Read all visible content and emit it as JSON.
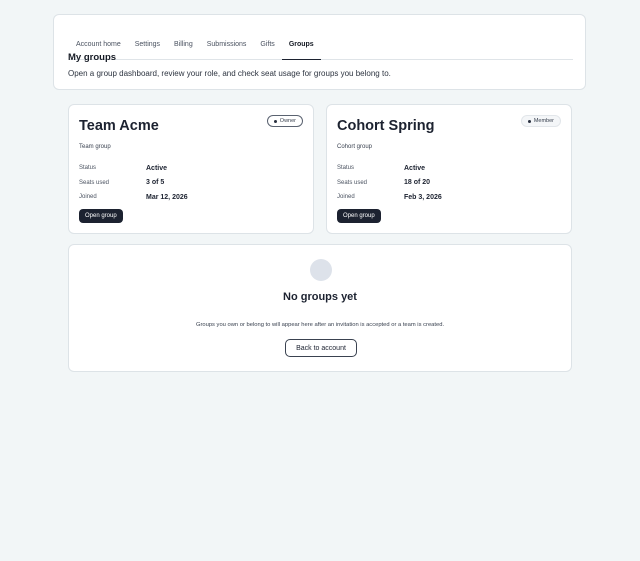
{
  "nav": {
    "tabs": [
      {
        "label": "Account home"
      },
      {
        "label": "Settings"
      },
      {
        "label": "Billing"
      },
      {
        "label": "Submissions"
      },
      {
        "label": "Gifts"
      },
      {
        "label": "Groups",
        "active": true
      }
    ]
  },
  "header": {
    "title": "My groups",
    "description": "Open a group dashboard, review your role, and check seat usage for groups you belong to."
  },
  "groups": [
    {
      "name": "Team Acme",
      "role": "Owner",
      "type": "Team group",
      "meta": [
        {
          "label": "Status",
          "value": "Active"
        },
        {
          "label": "Seats used",
          "value": "3 of 5"
        },
        {
          "label": "Joined",
          "value": "Mar 12, 2026"
        }
      ],
      "button": "Open group"
    },
    {
      "name": "Cohort Spring",
      "role": "Member",
      "type": "Cohort group",
      "meta": [
        {
          "label": "Status",
          "value": "Active"
        },
        {
          "label": "Seats used",
          "value": "18 of 20"
        },
        {
          "label": "Joined",
          "value": "Feb 3, 2026"
        }
      ],
      "button": "Open group"
    }
  ],
  "empty_state": {
    "icon": "placeholder-circle-icon",
    "title": "No groups yet",
    "text": "Groups you own or belong to will appear here after an invitation is accepted or a team is created.",
    "button": "Back to account"
  },
  "colors": {
    "background": "#f2f6f7",
    "primary_button": "#1c2230",
    "card": "#ffffff"
  }
}
